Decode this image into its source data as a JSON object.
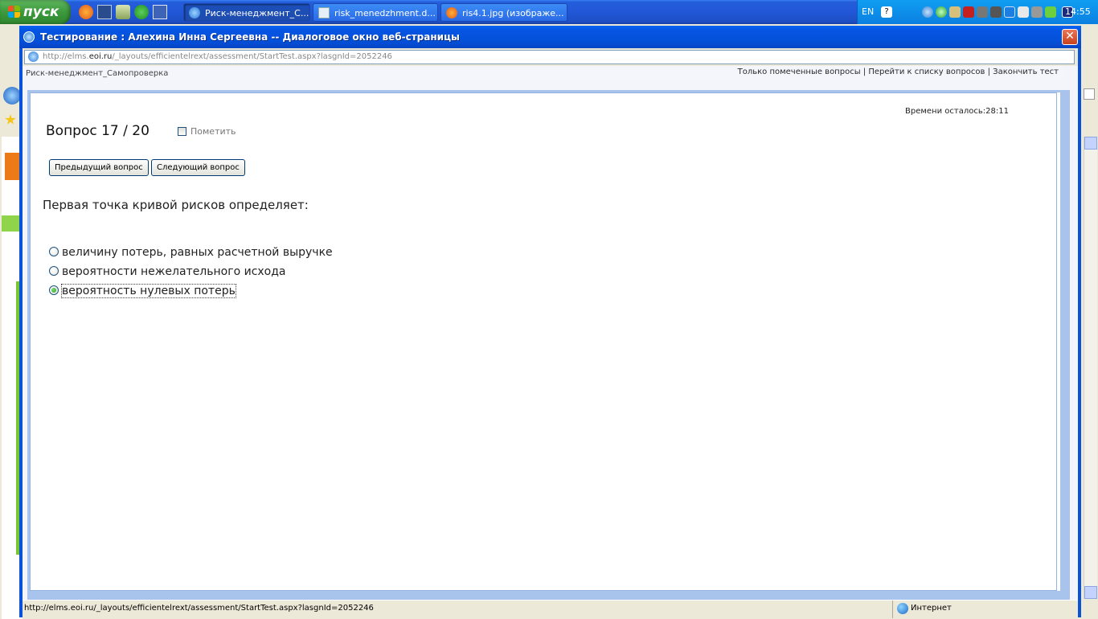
{
  "taskbar": {
    "start_label": "пуск",
    "tasks": [
      {
        "label": "Риск-менеджмент_С...",
        "icon": "ie-icon"
      },
      {
        "label": "risk_menedzhment.d...",
        "icon": "document-icon"
      },
      {
        "label": "ris4.1.jpg (изображе...",
        "icon": "firefox-icon"
      }
    ],
    "language": "EN",
    "clock": "14:55"
  },
  "dialog": {
    "title": "Тестирование : Алехина Инна Сергеевна -- Диалоговое окно веб-страницы",
    "address_prefix": "http://elms.",
    "address_host": "eoi.ru",
    "address_path": "/_layouts/efficientelrext/assessment/StartTest.aspx?lasgnId=2052246"
  },
  "linkbar": {
    "breadcrumb": "Риск-менеджмент_Самопроверка",
    "links": [
      "Только помеченные вопросы",
      "Перейти к списку вопросов",
      "Закончить тест"
    ],
    "separator": " | "
  },
  "test": {
    "time_left": "Времени осталось:28:11",
    "question_number": "Вопрос 17 / 20",
    "mark_label": "Пометить",
    "prev_button": "Предыдущий вопрос",
    "next_button": "Следующий вопрос",
    "question": "Первая точка кривой рисков определяет:",
    "options": [
      {
        "text": "величину потерь, равных расчетной выручке",
        "selected": false
      },
      {
        "text": "вероятности нежелательного исхода",
        "selected": false
      },
      {
        "text": "вероятность нулевых потерь",
        "selected": true
      }
    ]
  },
  "statusbar": {
    "url": "http://elms.eoi.ru/_layouts/efficientelrext/assessment/StartTest.aspx?lasgnId=2052246",
    "zone": "Интернет"
  },
  "colors": {
    "titlebar": "#0655e3",
    "frame_border": "#a9c4ec",
    "close_button": "#c8421d",
    "start_button": "#3c9a3c"
  }
}
